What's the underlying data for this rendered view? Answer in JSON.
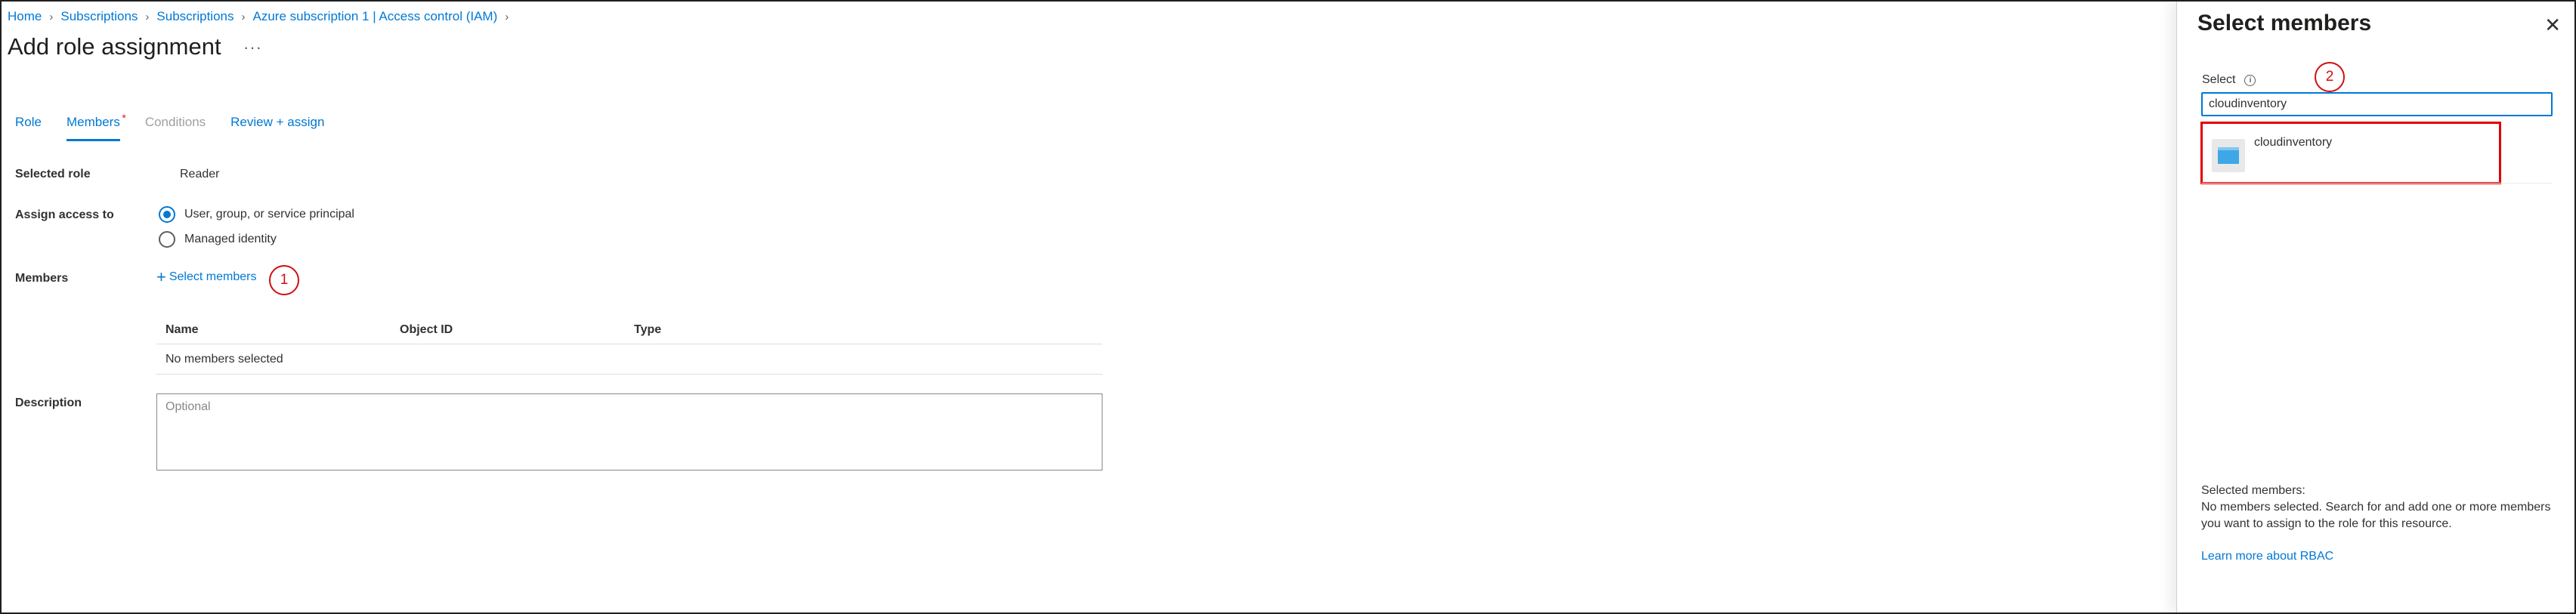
{
  "breadcrumb": {
    "items": [
      "Home",
      "Subscriptions",
      "Subscriptions",
      "Azure subscription 1 | Access control (IAM)"
    ]
  },
  "page": {
    "title": "Add role assignment",
    "more": "···"
  },
  "tabs": [
    {
      "label": "Role",
      "state": "enabled"
    },
    {
      "label": "Members",
      "state": "active"
    },
    {
      "label": "Conditions",
      "state": "disabled"
    },
    {
      "label": "Review + assign",
      "state": "enabled"
    }
  ],
  "form": {
    "selected_role_label": "Selected role",
    "selected_role_value": "Reader",
    "assign_access_label": "Assign access to",
    "assign_options": [
      "User, group, or service principal",
      "Managed identity"
    ],
    "assign_selected": "User, group, or service principal",
    "members_label": "Members",
    "select_members_link": "Select members",
    "table": {
      "columns": [
        "Name",
        "Object ID",
        "Type"
      ],
      "empty_text": "No members selected"
    },
    "description_label": "Description",
    "description_placeholder": "Optional"
  },
  "callouts": [
    "1",
    "2"
  ],
  "panel": {
    "title": "Select members",
    "select_label": "Select",
    "search_value": "cloudinventory",
    "results": [
      {
        "name": "cloudinventory",
        "icon": "virtual-machine-icon"
      }
    ],
    "selected_members_heading": "Selected members:",
    "selected_members_text": "No members selected. Search for and add one or more members you want to assign to the role for this resource.",
    "learn_more": "Learn more about RBAC"
  },
  "colors": {
    "accent": "#0078d4",
    "callout": "#d01010",
    "highlight": "#e00000"
  }
}
